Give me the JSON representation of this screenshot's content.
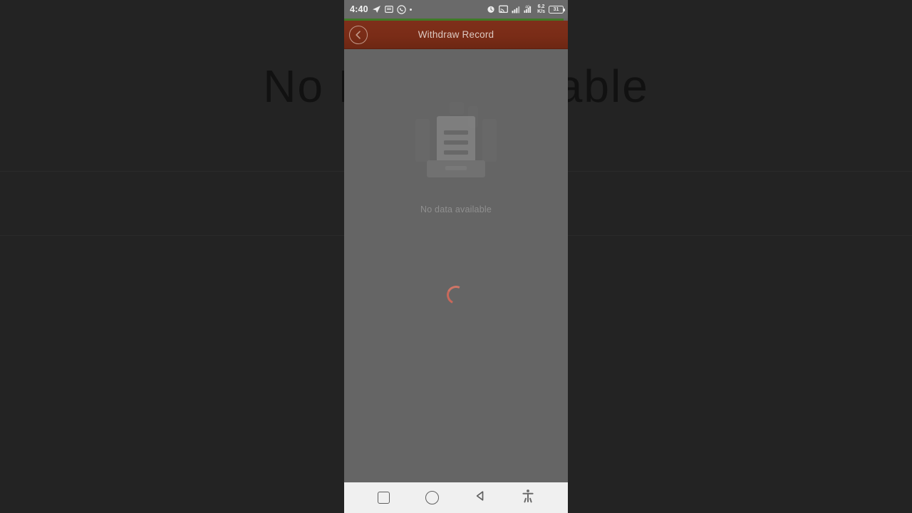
{
  "background": {
    "page_text": "No Data Available"
  },
  "phone": {
    "status_bar": {
      "time": "4:40",
      "left_icons": [
        "telegram-icon",
        "messenger-icon",
        "whatsapp-icon",
        "notification-dot-icon"
      ],
      "right_icons": [
        "alarm-icon",
        "screen-cast-icon",
        "signal-bars-icon",
        "dual-sim-signal-icon"
      ],
      "data_speed_value": "6.2",
      "data_speed_unit": "K/s",
      "battery_level": "31"
    },
    "app_bar": {
      "title": "Withdraw Record",
      "back_icon": "chevron-left-circle-icon",
      "background_color": "#7a2c17",
      "title_color": "#dcc9c2"
    },
    "loading_progress": {
      "percent": 98,
      "color": "#3f7a27"
    },
    "content": {
      "empty_state_icon": "document-tray-icon",
      "empty_state_text": "No data available",
      "spinner_icon": "loading-spinner-icon",
      "spinner_color": "#c9685a",
      "background_color": "#656565"
    },
    "nav_bar": {
      "buttons": [
        {
          "name": "recent-apps-button",
          "icon": "square-icon"
        },
        {
          "name": "home-button",
          "icon": "circle-icon"
        },
        {
          "name": "back-button",
          "icon": "triangle-left-icon"
        },
        {
          "name": "accessibility-button",
          "icon": "accessibility-person-icon"
        }
      ],
      "background_color": "#f0f0f0"
    }
  }
}
